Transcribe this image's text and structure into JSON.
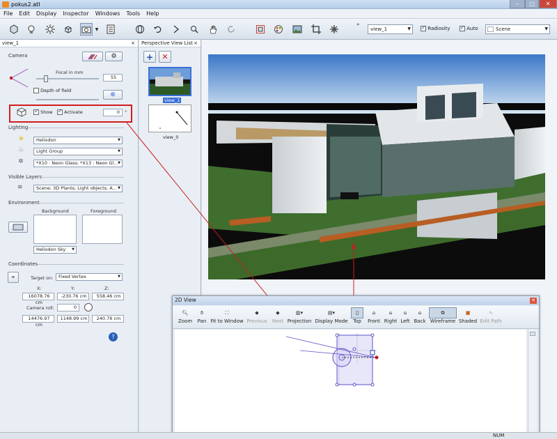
{
  "window": {
    "title": "pokus2.atl"
  },
  "menu": [
    "File",
    "Edit",
    "Display",
    "Inspector",
    "Windows",
    "Tools",
    "Help"
  ],
  "toolbar": {
    "view_select": "view_1",
    "radiosity_label": "Radiosity",
    "radiosity_checked": true,
    "auto_label": "Auto",
    "auto_checked": true,
    "scene_select": "Scene"
  },
  "left_panel": {
    "header": "view_1",
    "camera": {
      "section": "Camera",
      "focal_label": "Focal in mm",
      "focal_value": "55",
      "dof_label": "Depth of field",
      "dof_checked": false,
      "show_label": "Show",
      "show_checked": true,
      "activate_label": "Activate",
      "activate_checked": true,
      "angle_value": "0",
      "angle_unit": "°"
    },
    "lighting": {
      "section": "Lighting",
      "sun": "Heliodon",
      "light_group": "Light Group",
      "lights": "*X10 : Neon Glass; *X13 : Neon Gl..."
    },
    "visible_layers": {
      "section": "Visible Layers",
      "layers": "Scene; 3D Plants; Light objects; A..."
    },
    "environment": {
      "section": "Environment",
      "background_label": "Background",
      "foreground_label": "Foreground",
      "sky": "Heliodon Sky"
    },
    "coordinates": {
      "section": "Coordinates",
      "target_label": "Target on:",
      "target_value": "Fixed Vertex",
      "x_label": "X:",
      "y_label": "Y:",
      "z_label": "Z:",
      "x": "16078.76 cm",
      "y": "-230.76 cm",
      "z": "558.46 cm",
      "roll_label": "Camera roll:",
      "roll_value": "0",
      "tx": "14476.97 cm",
      "ty": "1148.99 cm",
      "tz": "240.76 cm"
    }
  },
  "view_list": {
    "header": "Perspective View List",
    "items": [
      "view_1",
      "view_0"
    ]
  },
  "dialog_2d": {
    "title": "2D View",
    "tools": [
      {
        "label": "Zoom",
        "icon": "zoom-icon",
        "disabled": false,
        "selected": false
      },
      {
        "label": "Pan",
        "icon": "pan-icon",
        "disabled": false,
        "selected": false
      },
      {
        "label": "Fit to Window",
        "icon": "fit-window-icon",
        "disabled": false,
        "selected": false
      },
      {
        "label": "Previous",
        "icon": "previous-icon",
        "disabled": true,
        "selected": false
      },
      {
        "label": "Next",
        "icon": "next-icon",
        "disabled": true,
        "selected": false
      },
      {
        "label": "Projection",
        "icon": "projection-icon",
        "disabled": false,
        "selected": false
      },
      {
        "label": "Display Mode",
        "icon": "display-mode-icon",
        "disabled": false,
        "selected": false
      },
      {
        "label": "Top",
        "icon": "top-view-icon",
        "disabled": false,
        "selected": true
      },
      {
        "label": "Front",
        "icon": "front-view-icon",
        "disabled": false,
        "selected": false
      },
      {
        "label": "Right",
        "icon": "right-view-icon",
        "disabled": false,
        "selected": false
      },
      {
        "label": "Left",
        "icon": "left-view-icon",
        "disabled": false,
        "selected": false
      },
      {
        "label": "Back",
        "icon": "back-view-icon",
        "disabled": false,
        "selected": false
      },
      {
        "label": "Wireframe",
        "icon": "wireframe-icon",
        "disabled": false,
        "selected": true
      },
      {
        "label": "Shaded",
        "icon": "shaded-icon",
        "disabled": false,
        "selected": false
      },
      {
        "label": "Edit Path",
        "icon": "edit-path-icon",
        "disabled": true,
        "selected": false
      }
    ]
  },
  "status": {
    "num": "NUM"
  },
  "colors": {
    "highlight": "#d11d1d",
    "selection": "#3a6fd8"
  }
}
